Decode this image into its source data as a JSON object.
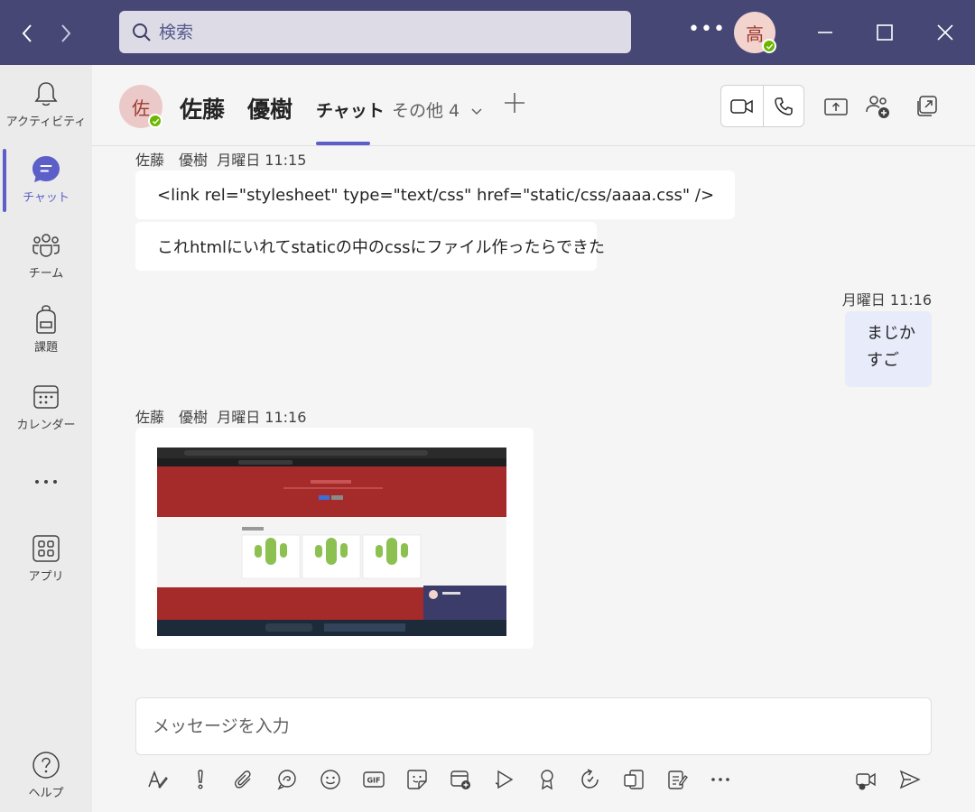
{
  "search": {
    "placeholder": "検索"
  },
  "me": {
    "avatar_initial": "高"
  },
  "rail": {
    "items": [
      {
        "label": "アクティビティ"
      },
      {
        "label": "チャット"
      },
      {
        "label": "チーム"
      },
      {
        "label": "課題"
      },
      {
        "label": "カレンダー"
      },
      {
        "label": ""
      },
      {
        "label": "アプリ"
      },
      {
        "label": "ヘルプ"
      }
    ]
  },
  "header": {
    "peer_initial": "佐",
    "peer_name": "佐藤　優樹",
    "tab_chat": "チャット",
    "tab_more": "その他 4",
    "accent": "#5b5fc7"
  },
  "messages": {
    "block1": {
      "sender": "佐藤　優樹",
      "time": "月曜日 11:15",
      "lines": [
        "<link rel=\"stylesheet\" type=\"text/css\" href=\"static/css/aaaa.css\" />",
        "これhtmlにいれてstaticの中のcssにファイル作ったらできた"
      ]
    },
    "mine": {
      "time": "月曜日 11:16",
      "lines": [
        "まじか",
        "すご"
      ]
    },
    "block2": {
      "sender": "佐藤　優樹",
      "time": "月曜日 11:16"
    }
  },
  "compose": {
    "placeholder": "メッセージを入力"
  },
  "colors": {
    "titlebar": "#464775",
    "presence": "#6bb700",
    "my_bubble": "#e8ebfa"
  }
}
